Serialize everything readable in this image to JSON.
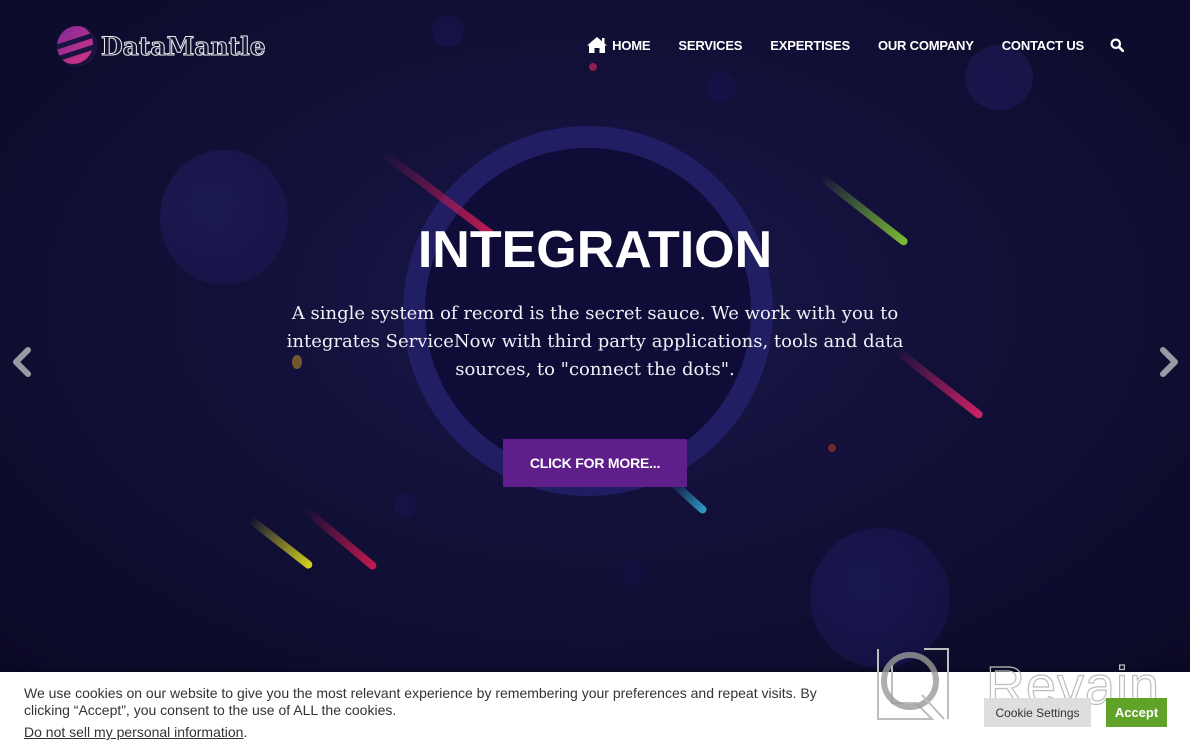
{
  "brand": {
    "name": "DataMantle",
    "colors": {
      "accent": "#5e1f8b",
      "accept": "#61a229",
      "background": "#0d0c2c"
    }
  },
  "nav": {
    "items": [
      {
        "label": "HOME",
        "icon": "home-icon"
      },
      {
        "label": "SERVICES"
      },
      {
        "label": "EXPERTISES"
      },
      {
        "label": "OUR COMPANY"
      },
      {
        "label": "CONTACT US"
      }
    ],
    "search_icon": "search-icon"
  },
  "hero": {
    "title": "INTEGRATION",
    "subtitle": "A single system of record is the secret sauce. We work with you to integrates ServiceNow with third party applications, tools and data sources, to \"connect the dots\".",
    "cta_label": "CLICK FOR MORE...",
    "prev_icon": "chevron-left-icon",
    "next_icon": "chevron-right-icon"
  },
  "cookie_banner": {
    "text": "We use cookies on our website to give you the most relevant experience by remembering your preferences and repeat visits. By clicking “Accept”, you consent to the use of ALL the cookies.",
    "link_text": "Do not sell my personal information",
    "link_suffix": ".",
    "settings_label": "Cookie Settings",
    "accept_label": "Accept"
  },
  "watermark": {
    "text": "Revain"
  }
}
